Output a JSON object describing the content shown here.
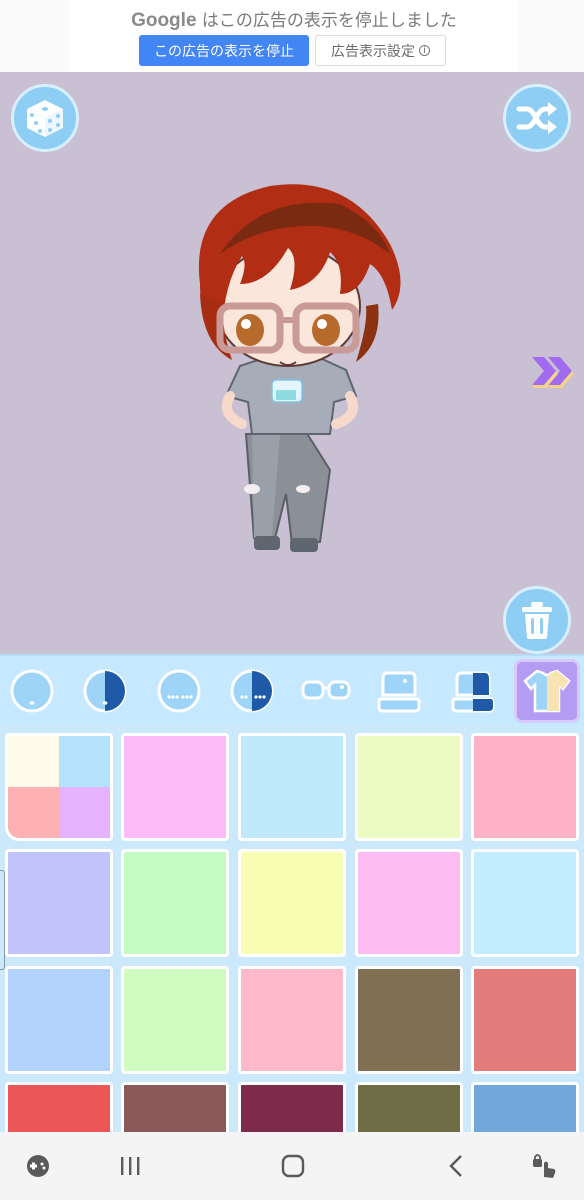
{
  "ad": {
    "brand": "Google",
    "message": "はこの広告の表示を停止しました",
    "stop_button": "この広告の表示を停止",
    "settings_button": "広告表示設定",
    "info_glyph": "i"
  },
  "stage": {
    "background": "#c9c0d3",
    "buttons": {
      "dice": "dice-icon",
      "shuffle": "shuffle-icon",
      "trash": "trash-icon",
      "next": "double-chevron-right-icon"
    }
  },
  "tabs": {
    "items": [
      {
        "name": "face-icon"
      },
      {
        "name": "face-half-icon"
      },
      {
        "name": "face-eyes-icon"
      },
      {
        "name": "face-eyes-half-icon"
      },
      {
        "name": "glasses-icon"
      },
      {
        "name": "top-icon"
      },
      {
        "name": "top-half-icon"
      },
      {
        "name": "shirt-icon",
        "active": true
      }
    ]
  },
  "swatches": [
    [
      "multi",
      "#fdbcf9",
      "#c0eafc",
      "#ecfbc2",
      "#feb2c8"
    ],
    [
      "#c3c3fc",
      "#c3fbc3",
      "#f8fdb4",
      "#fdbdf2",
      "#c3edfe"
    ],
    [
      "#b1d3fd",
      "#d0fcc1",
      "#feb9cb",
      "#7f7054",
      "#e27b7b"
    ],
    [
      "#eb5757",
      "#8b5959",
      "#7e2b4b",
      "#6e6d45",
      "#72a7dc"
    ]
  ],
  "multi_swatch": [
    "#fffbea",
    "#b4e1fc",
    "#feb1b2",
    "#e5b3fd"
  ],
  "nav": {
    "items": [
      "game-controller-icon",
      "recent-apps-icon",
      "home-icon",
      "back-icon",
      "touch-lock-icon"
    ]
  }
}
